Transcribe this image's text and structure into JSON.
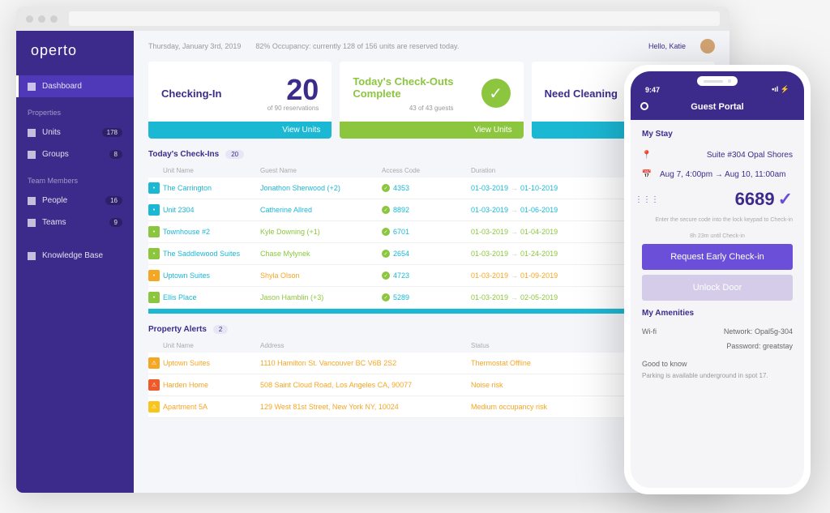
{
  "logo": "operto",
  "topbar": {
    "date": "Thursday, January 3rd, 2019",
    "occupancy": "82% Occupancy: currently 128 of 156 units are reserved today.",
    "greeting": "Hello, Katie"
  },
  "sidebar": {
    "dashboard": "Dashboard",
    "properties_label": "Properties",
    "units": {
      "label": "Units",
      "badge": "178"
    },
    "groups": {
      "label": "Groups",
      "badge": "8"
    },
    "team_label": "Team Members",
    "people": {
      "label": "People",
      "badge": "16"
    },
    "teams": {
      "label": "Teams",
      "badge": "9"
    },
    "kb": "Knowledge Base"
  },
  "cards": {
    "checkin": {
      "title": "Checking-In",
      "num": "20",
      "sub": "of 90 reservations",
      "cta": "View Units"
    },
    "checkout": {
      "title_l1": "Today's Check-Outs",
      "title_l2": "Complete",
      "sub": "43 of 43 guests",
      "cta": "View Units"
    },
    "clean": {
      "title": "Need Cleaning"
    }
  },
  "checkins": {
    "title": "Today's Check-Ins",
    "count": "20",
    "cols": {
      "unit": "Unit Name",
      "guest": "Guest Name",
      "code": "Access Code",
      "dur": "Duration"
    },
    "rows": [
      {
        "badge": "teal",
        "unit": "The Carrington",
        "guest": "Jonathon Sherwood (+2)",
        "gclass": "guest-teal",
        "code": "4353",
        "from": "01-03-2019",
        "to": "01-10-2019",
        "dclass": ""
      },
      {
        "badge": "teal",
        "unit": "Unit 2304",
        "guest": "Catherine Allred",
        "gclass": "guest-teal",
        "code": "8892",
        "from": "01-03-2019",
        "to": "01-06-2019",
        "dclass": ""
      },
      {
        "badge": "green",
        "unit": "Townhouse #2",
        "guest": "Kyle Downing (+1)",
        "gclass": "guest-green",
        "code": "6701",
        "from": "01-03-2019",
        "to": "01-04-2019",
        "dclass": "green"
      },
      {
        "badge": "green",
        "unit": "The Saddlewood Suites",
        "guest": "Chase Mylynek",
        "gclass": "guest-green",
        "code": "2654",
        "from": "01-03-2019",
        "to": "01-24-2019",
        "dclass": "green"
      },
      {
        "badge": "orange",
        "unit": "Uptown Suites",
        "guest": "Shyla Olson",
        "gclass": "guest-orange",
        "code": "4723",
        "from": "01-03-2019",
        "to": "01-09-2019",
        "dclass": "orange"
      },
      {
        "badge": "green",
        "unit": "Ellis Place",
        "guest": "Jason Hamblin (+3)",
        "gclass": "guest-green",
        "code": "5289",
        "from": "01-03-2019",
        "to": "02-05-2019",
        "dclass": "green"
      }
    ]
  },
  "alerts": {
    "title": "Property Alerts",
    "count": "2",
    "cols": {
      "unit": "Unit Name",
      "addr": "Address",
      "status": "Status"
    },
    "rows": [
      {
        "badge": "orange",
        "unit": "Uptown Suites",
        "addr": "1110 Hamilton St. Vancouver BC V6B 2S2",
        "status": "Thermostat Offline"
      },
      {
        "badge": "red",
        "unit": "Harden Home",
        "addr": "508 Saint Cloud Road, Los Angeles CA, 90077",
        "status": "Noise risk"
      },
      {
        "badge": "yellow",
        "unit": "Apartment 5A",
        "addr": "129 West 81st Street, New York NY, 10024",
        "status": "Medium occupancy risk"
      }
    ]
  },
  "phone": {
    "time": "9:47",
    "header": "Guest Portal",
    "stay_title": "My Stay",
    "suite": "Suite #304 Opal Shores",
    "dates": "Aug 7, 4:00pm → Aug 10, 11:00am",
    "code": "6689",
    "code_hint": "Enter the secure code into the lock keypad to Check-in",
    "countdown": "8h 23m until Check-in",
    "btn1": "Request Early Check-in",
    "btn2": "Unlock Door",
    "amenities_title": "My Amenities",
    "wifi_label": "Wi-fi",
    "wifi_net_label": "Network:",
    "wifi_net": "Opal5g-304",
    "wifi_pw_label": "Password:",
    "wifi_pw": "greatstay",
    "gtk": "Good to know",
    "gtk_body": "Parking is available underground in spot 17."
  }
}
